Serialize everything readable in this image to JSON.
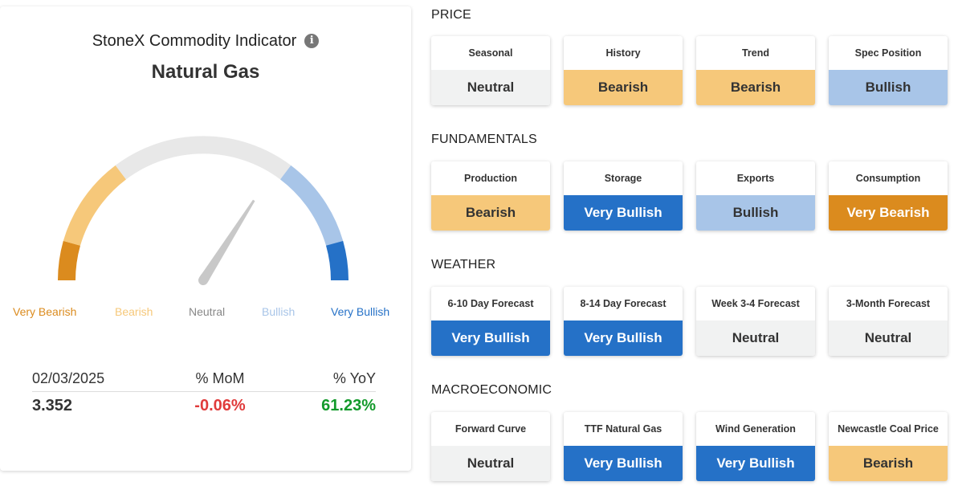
{
  "indicator": {
    "title": "StoneX Commodity Indicator",
    "commodity": "Natural Gas",
    "info_icon": "info-icon",
    "needle_fraction": 0.68,
    "scale_labels": [
      "Very Bearish",
      "Bearish",
      "Neutral",
      "Bullish",
      "Very Bullish"
    ],
    "metrics": {
      "date": "02/03/2025",
      "mom_label": "% MoM",
      "yoy_label": "% YoY",
      "price": "3.352",
      "mom": "-0.06%",
      "yoy": "61.23%"
    }
  },
  "colors": {
    "Very Bearish": "#db8b1e",
    "Bearish": "#f6c87a",
    "Neutral": "#f1f2f2",
    "Bullish": "#a8c5e8",
    "Very Bullish": "#2571c7",
    "negative": "#e03b3b",
    "positive": "#139a2b"
  },
  "sections": [
    {
      "title": "PRICE",
      "cards": [
        {
          "label": "Seasonal",
          "value": "Neutral"
        },
        {
          "label": "History",
          "value": "Bearish"
        },
        {
          "label": "Trend",
          "value": "Bearish"
        },
        {
          "label": "Spec Position",
          "value": "Bullish"
        }
      ]
    },
    {
      "title": "FUNDAMENTALS",
      "cards": [
        {
          "label": "Production",
          "value": "Bearish"
        },
        {
          "label": "Storage",
          "value": "Very Bullish"
        },
        {
          "label": "Exports",
          "value": "Bullish"
        },
        {
          "label": "Consumption",
          "value": "Very Bearish"
        }
      ]
    },
    {
      "title": "WEATHER",
      "cards": [
        {
          "label": "6-10 Day Forecast",
          "value": "Very Bullish"
        },
        {
          "label": "8-14 Day Forecast",
          "value": "Very Bullish"
        },
        {
          "label": "Week 3-4 Forecast",
          "value": "Neutral"
        },
        {
          "label": "3-Month Forecast",
          "value": "Neutral"
        }
      ]
    },
    {
      "title": "MACROECONOMIC",
      "cards": [
        {
          "label": "Forward Curve",
          "value": "Neutral"
        },
        {
          "label": "TTF Natural Gas",
          "value": "Very Bullish"
        },
        {
          "label": "Wind Generation",
          "value": "Very Bullish"
        },
        {
          "label": "Newcastle Coal Price",
          "value": "Bearish"
        }
      ]
    }
  ]
}
